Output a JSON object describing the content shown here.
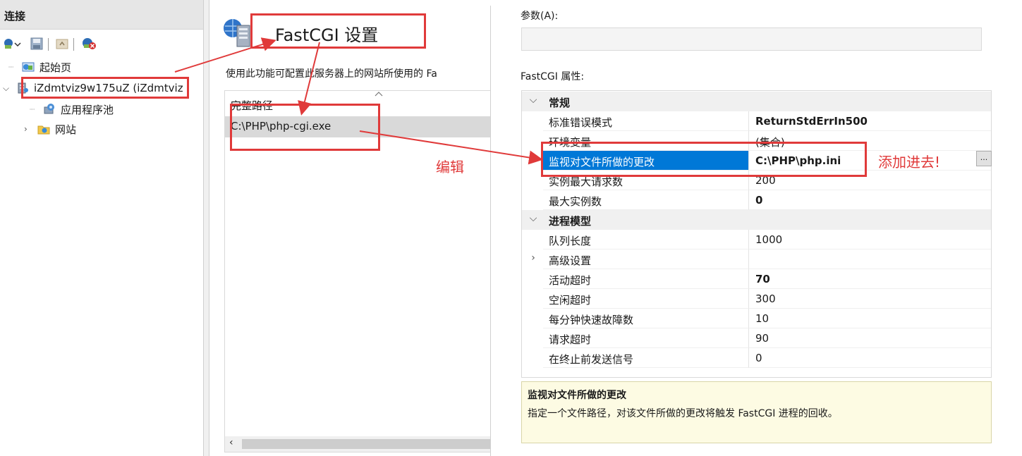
{
  "connections": {
    "header": "连接",
    "toolbar": [
      {
        "icon": "connect-icon"
      },
      {
        "icon": "save-icon"
      },
      {
        "icon": "up-level-icon"
      },
      {
        "icon": "disconnect-icon"
      }
    ],
    "tree": {
      "start_page": "起始页",
      "server": "iZdmtviz9w175uZ (iZdmtviz",
      "app_pools": "应用程序池",
      "sites": "网站"
    }
  },
  "fastcgi": {
    "title": "FastCGI 设置",
    "description": "使用此功能可配置此服务器上的网站所使用的 Fa",
    "column_header": "完整路径",
    "rows": [
      "C:\\PHP\\php-cgi.exe"
    ]
  },
  "dialog": {
    "args_label": "参数(A):",
    "args_value": "",
    "props_label": "FastCGI 属性:",
    "categories": [
      {
        "name": "常规",
        "expanded": true,
        "props": [
          {
            "name": "标准错误模式",
            "value": "ReturnStdErrIn500",
            "bold": true
          },
          {
            "name": "环境变量",
            "value": "(集合)",
            "bold": false
          },
          {
            "name": "监视对文件所做的更改",
            "value": "C:\\PHP\\php.ini",
            "bold": true,
            "selected": true
          },
          {
            "name": "实例最大请求数",
            "value": "200",
            "bold": false
          },
          {
            "name": "最大实例数",
            "value": "0",
            "bold": true
          }
        ]
      },
      {
        "name": "进程模型",
        "expanded": true,
        "props": [
          {
            "name": "队列长度",
            "value": "1000",
            "bold": false
          },
          {
            "name": "高级设置",
            "value": "",
            "bold": false,
            "collapsible": true
          },
          {
            "name": "活动超时",
            "value": "70",
            "bold": true
          },
          {
            "name": "空闲超时",
            "value": "300",
            "bold": false
          },
          {
            "name": "每分钟快速故障数",
            "value": "10",
            "bold": false
          },
          {
            "name": "请求超时",
            "value": "90",
            "bold": false
          },
          {
            "name": "在终止前发送信号",
            "value": "0",
            "bold": false
          }
        ]
      }
    ],
    "ellipsis_label": "...",
    "desc_title": "监视对文件所做的更改",
    "desc_text": "指定一个文件路径，对该文件所做的更改将触发 FastCGI 进程的回收。"
  },
  "annotations": {
    "edit_label": "编辑",
    "add_label": "添加进去!",
    "color": "#e03a3a"
  },
  "colors": {
    "selection": "#0078d7",
    "description_bg": "#fdfbe3"
  }
}
